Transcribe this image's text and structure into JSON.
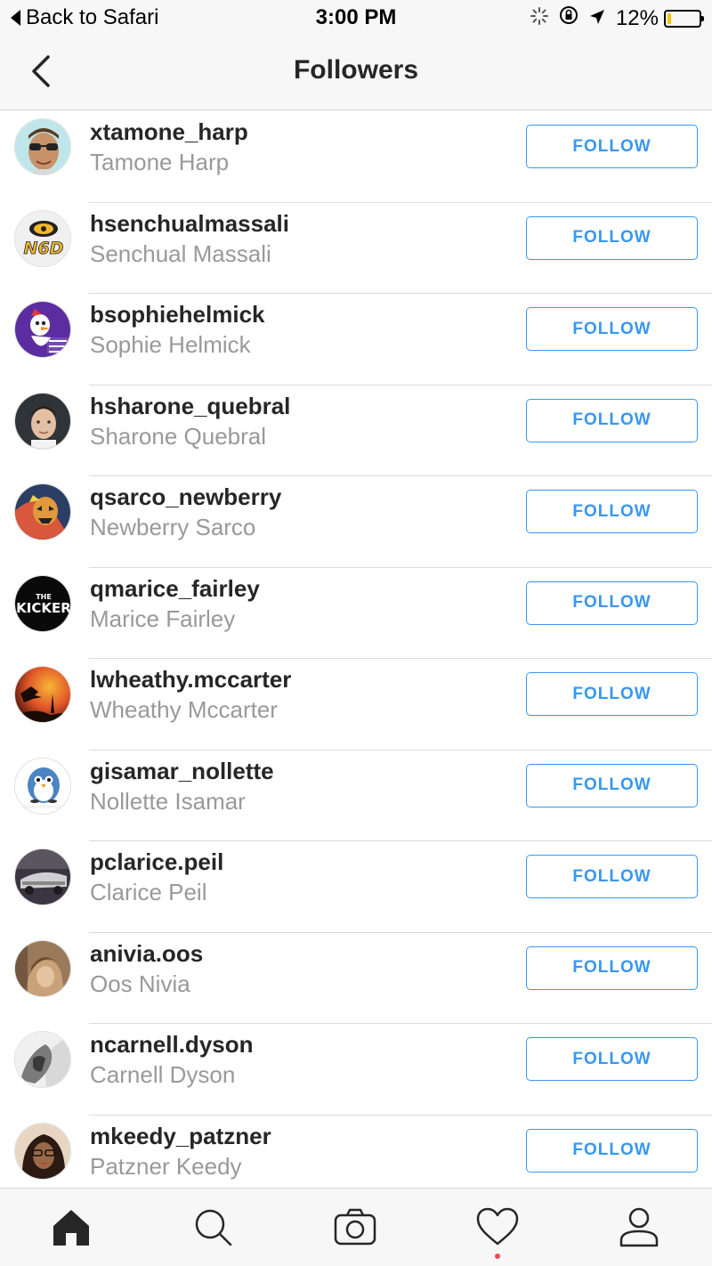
{
  "status_bar": {
    "back_app": "Back to Safari",
    "time": "3:00 PM",
    "battery": "12%",
    "battery_level": 0.12
  },
  "nav": {
    "title": "Followers",
    "back_icon": "chevron-left-icon"
  },
  "followers": [
    {
      "username": "xtamone_harp",
      "full_name": "Tamone Harp",
      "button": "FOLLOW"
    },
    {
      "username": "hsenchualmassali",
      "full_name": "Senchual Massali",
      "button": "FOLLOW"
    },
    {
      "username": "bsophiehelmick",
      "full_name": "Sophie Helmick",
      "button": "FOLLOW"
    },
    {
      "username": "hsharone_quebral",
      "full_name": "Sharone Quebral",
      "button": "FOLLOW"
    },
    {
      "username": "qsarco_newberry",
      "full_name": "Newberry Sarco",
      "button": "FOLLOW"
    },
    {
      "username": "qmarice_fairley",
      "full_name": "Marice Fairley",
      "button": "FOLLOW"
    },
    {
      "username": "lwheathy.mccarter",
      "full_name": "Wheathy Mccarter",
      "button": "FOLLOW"
    },
    {
      "username": "gisamar_nollette",
      "full_name": "Nollette Isamar",
      "button": "FOLLOW"
    },
    {
      "username": "pclarice.peil",
      "full_name": "Clarice Peil",
      "button": "FOLLOW"
    },
    {
      "username": "anivia.oos",
      "full_name": "Oos Nivia",
      "button": "FOLLOW"
    },
    {
      "username": "ncarnell.dyson",
      "full_name": "Carnell Dyson",
      "button": "FOLLOW"
    },
    {
      "username": "mkeedy_patzner",
      "full_name": "Patzner Keedy",
      "button": "FOLLOW"
    }
  ],
  "avatar_text": {
    "a2": "N6D",
    "a6_top": "THE",
    "a6_main": "KICKER"
  },
  "tab_bar": {
    "tabs": [
      "home-icon",
      "search-icon",
      "camera-icon",
      "heart-icon",
      "profile-icon"
    ],
    "active": "home-icon"
  },
  "colors": {
    "accent": "#3897f0",
    "notification": "#ed4956",
    "secondary_text": "#999999"
  }
}
